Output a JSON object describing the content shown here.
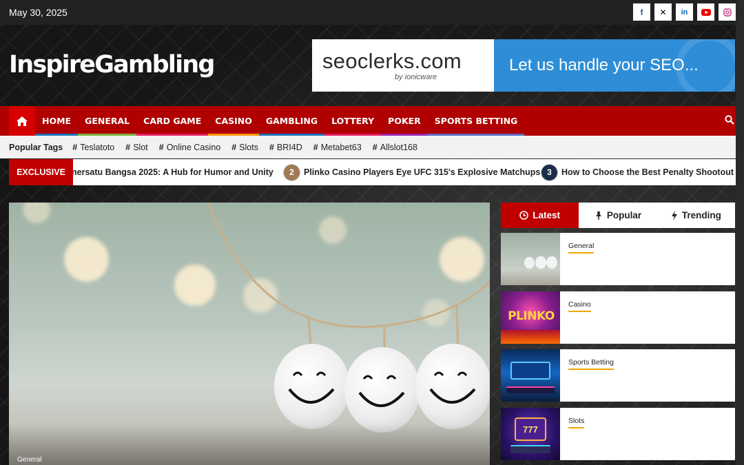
{
  "topbar": {
    "date": "May 30, 2025",
    "social": [
      "facebook-icon",
      "x-icon",
      "linkedin-icon",
      "youtube-icon",
      "instagram-icon"
    ]
  },
  "header": {
    "logo": "InspireGambling",
    "ad": {
      "brand": "seoclerks.com",
      "sub": "by ionicware",
      "tagline": "Let us handle your SEO..."
    }
  },
  "nav": {
    "items": [
      {
        "label": "HOME",
        "underline": "#1e73be"
      },
      {
        "label": "GENERAL",
        "underline": "#7cb342"
      },
      {
        "label": "CARD GAME",
        "underline": "#e91e63"
      },
      {
        "label": "CASINO",
        "underline": "#ff9800"
      },
      {
        "label": "GAMBLING",
        "underline": "#1e73be"
      },
      {
        "label": "LOTTERY",
        "underline": "#e91e63"
      },
      {
        "label": "POKER",
        "underline": "#9c27b0"
      },
      {
        "label": "SPORTS BETTING",
        "underline": "#5c6bc0"
      }
    ]
  },
  "tags": {
    "title": "Popular Tags",
    "items": [
      "Teslatoto",
      "Slot",
      "Online Casino",
      "Slots",
      "BRI4D",
      "Metabet63",
      "Allslot168"
    ]
  },
  "ticker": {
    "label": "EXCLUSIVE",
    "items": [
      {
        "num": "",
        "text": "nersatu Bangsa 2025: A Hub for Humor and Unity"
      },
      {
        "num": "2",
        "text": "Plinko Casino Players Eye UFC 315's Explosive Matchups"
      },
      {
        "num": "3",
        "text": "How to Choose the Best Penalty Shootout Betting"
      }
    ]
  },
  "hero": {
    "category": "General"
  },
  "sidebar": {
    "tabs": [
      "Latest",
      "Popular",
      "Trending"
    ],
    "items": [
      {
        "category": "General"
      },
      {
        "category": "Casino"
      },
      {
        "category": "Sports Betting"
      },
      {
        "category": "Slots"
      }
    ]
  },
  "colors": {
    "nav_bg": "#b00000",
    "accent_red": "#c00000",
    "ad_blue": "#2e8dd6",
    "category_underline": "#f2a600"
  }
}
